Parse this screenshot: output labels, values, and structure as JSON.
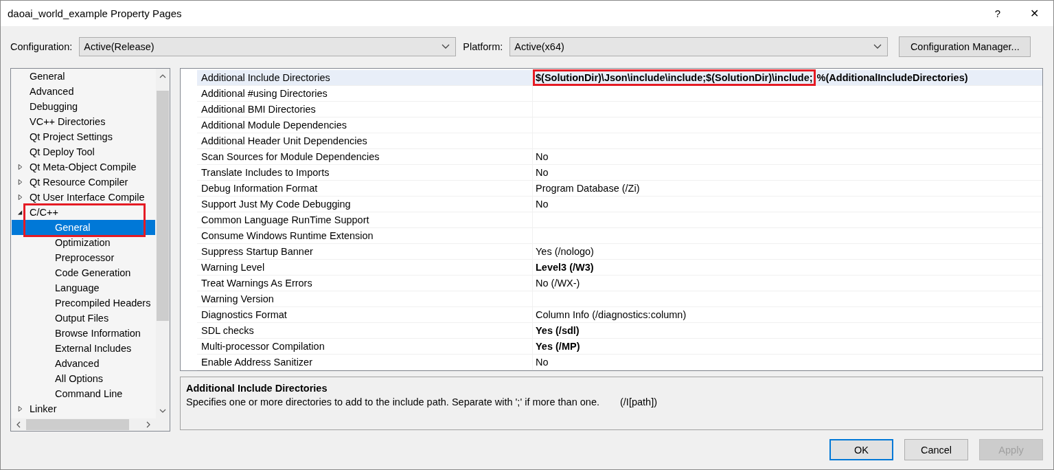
{
  "window": {
    "title": "daoai_world_example Property Pages",
    "help": "?",
    "close": "✕"
  },
  "configuration": {
    "label": "Configuration:",
    "value": "Active(Release)"
  },
  "platform": {
    "label": "Platform:",
    "value": "Active(x64)"
  },
  "config_manager": "Configuration Manager...",
  "tree": [
    {
      "label": "General",
      "kind": "page",
      "selected": false
    },
    {
      "label": "Advanced",
      "kind": "page",
      "selected": false
    },
    {
      "label": "Debugging",
      "kind": "page",
      "selected": false
    },
    {
      "label": "VC++ Directories",
      "kind": "page",
      "selected": false
    },
    {
      "label": "Qt Project Settings",
      "kind": "page",
      "selected": false
    },
    {
      "label": "Qt Deploy Tool",
      "kind": "page",
      "selected": false
    },
    {
      "label": "Qt Meta-Object Compile",
      "kind": "group",
      "expanded": false,
      "selected": false
    },
    {
      "label": "Qt Resource Compiler",
      "kind": "group",
      "expanded": false,
      "selected": false
    },
    {
      "label": "Qt User Interface Compile",
      "kind": "group",
      "expanded": false,
      "selected": false
    },
    {
      "label": "C/C++",
      "kind": "group",
      "expanded": true,
      "selected": false,
      "highlighted": true,
      "children": [
        {
          "label": "General",
          "selected": true
        },
        {
          "label": "Optimization",
          "selected": false
        },
        {
          "label": "Preprocessor",
          "selected": false
        },
        {
          "label": "Code Generation",
          "selected": false
        },
        {
          "label": "Language",
          "selected": false
        },
        {
          "label": "Precompiled Headers",
          "selected": false
        },
        {
          "label": "Output Files",
          "selected": false
        },
        {
          "label": "Browse Information",
          "selected": false
        },
        {
          "label": "External Includes",
          "selected": false
        },
        {
          "label": "Advanced",
          "selected": false
        },
        {
          "label": "All Options",
          "selected": false
        },
        {
          "label": "Command Line",
          "selected": false
        }
      ]
    },
    {
      "label": "Linker",
      "kind": "group",
      "expanded": false,
      "selected": false
    }
  ],
  "properties": [
    {
      "name": "Additional Include Directories",
      "selected": true,
      "bold": true,
      "highlighted_text": "$(SolutionDir)\\Json\\include\\include;$(SolutionDir)\\include;",
      "value": "%(AdditionalIncludeDirectories)"
    },
    {
      "name": "Additional #using Directories",
      "selected": false
    },
    {
      "name": "Additional BMI Directories",
      "selected": false
    },
    {
      "name": "Additional Module Dependencies",
      "selected": false
    },
    {
      "name": "Additional Header Unit Dependencies",
      "selected": false
    },
    {
      "name": "Scan Sources for Module Dependencies",
      "selected": false,
      "bold": false,
      "value": "No"
    },
    {
      "name": "Translate Includes to Imports",
      "selected": false,
      "bold": false,
      "value": "No"
    },
    {
      "name": "Debug Information Format",
      "selected": false,
      "bold": false,
      "value": "Program Database (/Zi)"
    },
    {
      "name": "Support Just My Code Debugging",
      "selected": false,
      "bold": false,
      "value": "No"
    },
    {
      "name": "Common Language RunTime Support",
      "selected": false
    },
    {
      "name": "Consume Windows Runtime Extension",
      "selected": false
    },
    {
      "name": "Suppress Startup Banner",
      "selected": false,
      "bold": false,
      "value": "Yes (/nologo)"
    },
    {
      "name": "Warning Level",
      "selected": false,
      "bold": true,
      "value": "Level3 (/W3)"
    },
    {
      "name": "Treat Warnings As Errors",
      "selected": false,
      "bold": false,
      "value": "No (/WX-)"
    },
    {
      "name": "Warning Version",
      "selected": false
    },
    {
      "name": "Diagnostics Format",
      "selected": false,
      "bold": false,
      "value": "Column Info (/diagnostics:column)"
    },
    {
      "name": "SDL checks",
      "selected": false,
      "bold": true,
      "value": "Yes (/sdl)"
    },
    {
      "name": "Multi-processor Compilation",
      "selected": false,
      "bold": true,
      "value": "Yes (/MP)"
    },
    {
      "name": "Enable Address Sanitizer",
      "selected": false,
      "bold": false,
      "value": "No"
    }
  ],
  "description": {
    "title": "Additional Include Directories",
    "text": "Specifies one or more directories to add to the include path. Separate with ';' if more than one.",
    "switch": "(/I[path])"
  },
  "buttons": [
    {
      "label": "OK",
      "kind": "default",
      "disabled": false
    },
    {
      "label": "Cancel",
      "kind": "normal",
      "disabled": false
    },
    {
      "label": "Apply",
      "kind": "normal",
      "disabled": true
    }
  ]
}
